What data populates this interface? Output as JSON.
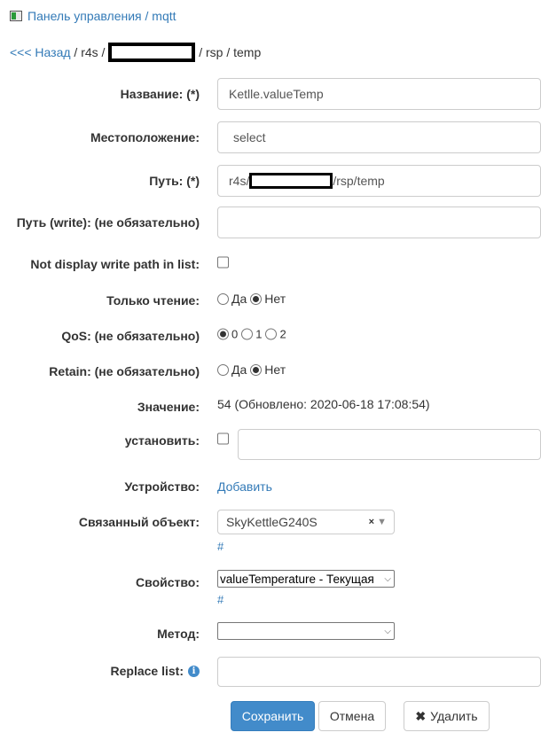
{
  "breadcrumb": {
    "panel": "Панель управления",
    "sep": " / ",
    "module": "mqtt"
  },
  "path": {
    "back": "<<< Назад",
    "p1": " / r4s / ",
    "p3": " / rsp / temp"
  },
  "form": {
    "title_label": "Название: (*)",
    "title_value": "Ketlle.valueTemp",
    "location_label": "Местоположение:",
    "location_value": "select",
    "path_label": "Путь: (*)",
    "path_prefix": "r4s/",
    "path_suffix": "/rsp/temp",
    "path_write_label": "Путь (write): (не обязательно)",
    "no_display_label": "Not display write path in list:",
    "readonly_label": "Только чтение:",
    "yes": "Да",
    "no": "Нет",
    "qos_label": "QoS: (не обязательно)",
    "qos_options": [
      "0",
      "1",
      "2"
    ],
    "qos_selected": "0",
    "retain_label": "Retain: (не обязательно)",
    "value_label": "Значение:",
    "value_text": "54 (Обновлено: 2020-06-18 17:08:54)",
    "set_label": "установить:",
    "device_label": "Устройство:",
    "device_link": "Добавить",
    "linked_label": "Связанный объект:",
    "linked_value": "SkyKettleG240S",
    "hash": "#",
    "property_label": "Свойство:",
    "property_value": "valueTemperature - Текущая",
    "method_label": "Метод:",
    "method_value": "",
    "replace_label": "Replace list:"
  },
  "buttons": {
    "save": "Сохранить",
    "cancel": "Отмена",
    "delete": "Удалить"
  },
  "colors": {
    "link": "#337ab7",
    "primary": "#428bca"
  }
}
